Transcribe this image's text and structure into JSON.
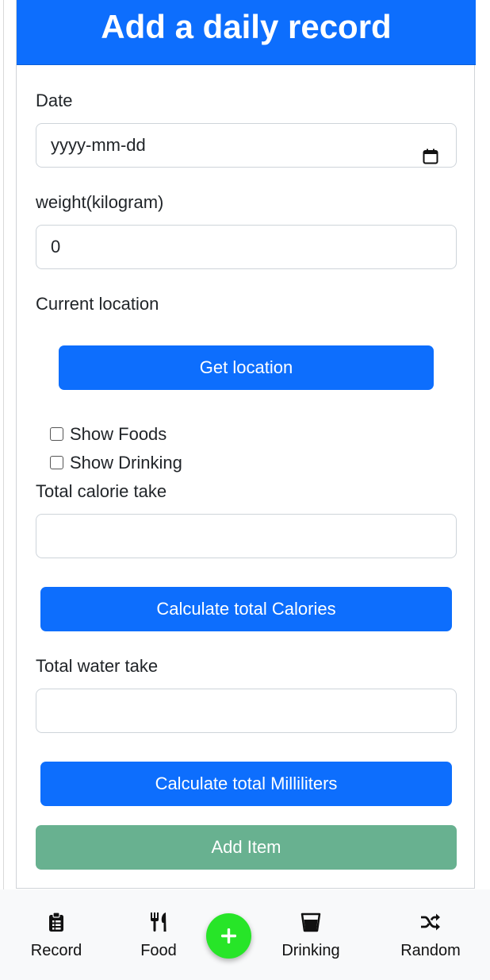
{
  "header": {
    "title": "Add a daily record"
  },
  "form": {
    "date": {
      "label": "Date",
      "placeholder": "yyyy-mm-dd"
    },
    "weight": {
      "label": "weight(kilogram)",
      "value": "0"
    },
    "location": {
      "label": "Current location",
      "button": "Get location"
    },
    "toggles": {
      "show_foods": "Show Foods",
      "show_drinking": "Show Drinking"
    },
    "calories": {
      "label": "Total calorie take",
      "value": "",
      "button": "Calculate total Calories"
    },
    "water": {
      "label": "Total water take",
      "value": "",
      "button": "Calculate total Milliliters"
    },
    "submit": "Add Item"
  },
  "nav": {
    "items": [
      {
        "label": "Record",
        "icon": "clipboard-list-icon"
      },
      {
        "label": "Food",
        "icon": "utensils-icon"
      },
      {
        "label": "Drinking",
        "icon": "glass-icon"
      },
      {
        "label": "Random",
        "icon": "shuffle-icon"
      }
    ],
    "fab_icon": "plus-icon"
  },
  "colors": {
    "primary": "#0d6efd",
    "add_button": "#68b190",
    "fab": "#27e528",
    "nav_background": "#f8f9fa"
  }
}
